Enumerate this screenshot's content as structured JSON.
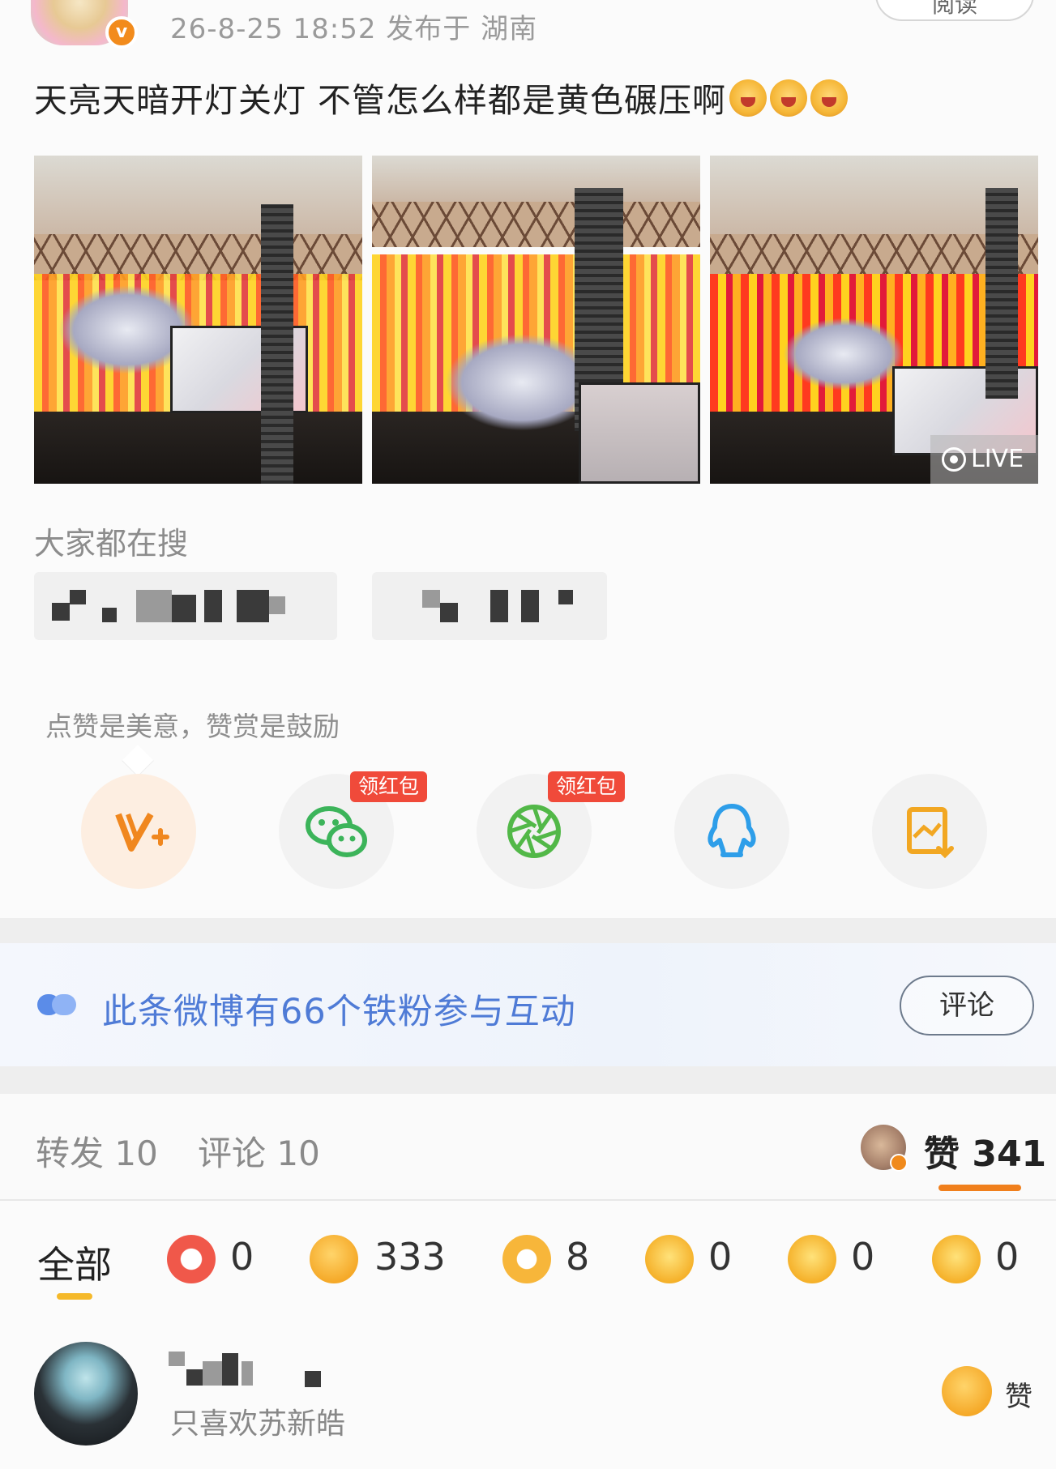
{
  "post": {
    "meta": "26-8-25 18:52  发布于 湖南",
    "read_label": "阅读",
    "text": "天亮天暗开灯关灯 不管怎么样都是黄色碾压啊",
    "live_label": "LIVE"
  },
  "search": {
    "title": "大家都在搜"
  },
  "share": {
    "tip": "点赞是美意，赞赏是鼓励",
    "hongbao_label": "领红包",
    "buttons": [
      {
        "icon": "vplus-icon"
      },
      {
        "icon": "wechat-icon"
      },
      {
        "icon": "moments-icon"
      },
      {
        "icon": "qq-icon"
      },
      {
        "icon": "save-image-icon"
      }
    ]
  },
  "fans": {
    "text": "此条微博有66个铁粉参与互动",
    "comment_button": "评论"
  },
  "tabs": {
    "repost": "转发 10",
    "comment": "评论 10",
    "like_prefix": "赞",
    "like_count": "341"
  },
  "reactions": {
    "all": "全部",
    "items": [
      {
        "icon": "reward-heart-icon",
        "count": "0"
      },
      {
        "icon": "thumbs-up-icon",
        "count": "333"
      },
      {
        "icon": "heart-bubble-icon",
        "count": "8"
      },
      {
        "icon": "laugh-icon",
        "count": "0"
      },
      {
        "icon": "surprise-icon",
        "count": "0"
      },
      {
        "icon": "sad-icon",
        "count": "0"
      }
    ]
  },
  "comment": {
    "text": "只喜欢苏新皓",
    "like_label": "赞"
  },
  "colors": {
    "accent_orange": "#f07f1c",
    "fan_blue": "#4f7bd6",
    "hongbao_red": "#f04a3a"
  }
}
